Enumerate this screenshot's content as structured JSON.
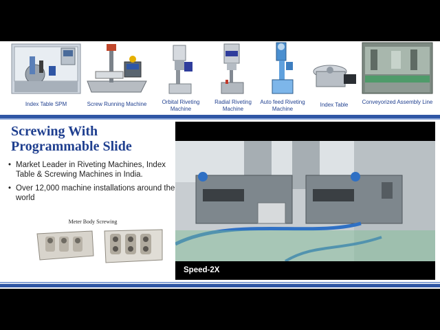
{
  "machines": [
    {
      "label": "Index Table SPM"
    },
    {
      "label": "Screw Running Machine"
    },
    {
      "label": "Orbital Riveting Machine"
    },
    {
      "label": "Radial Riveting Machine"
    },
    {
      "label": "Auto feed Riveting Machine"
    },
    {
      "label": "Index Table"
    },
    {
      "label": "Conveyorized Assembly Line"
    }
  ],
  "slide": {
    "title_line1": "Screwing With",
    "title_line2": "Programmable Slide",
    "bullets": [
      "Market Leader in Riveting Machines, Index Table & Screwing Machines in India.",
      "Over 12,000 machine installations around the world"
    ],
    "meter_caption": "Meter Body Screwing"
  },
  "video": {
    "caption": "Speed-2X"
  },
  "colors": {
    "title": "#1f3f8f",
    "divider": "#2f56a5",
    "background": "#000000"
  }
}
